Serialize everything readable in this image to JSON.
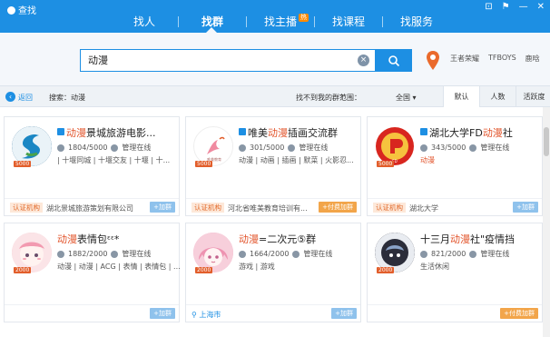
{
  "window": {
    "title": "查找",
    "controls": [
      "⊡",
      "⚑",
      "—",
      "✕"
    ]
  },
  "nav": [
    {
      "label": "找人",
      "hot": ""
    },
    {
      "label": "找群",
      "hot": ""
    },
    {
      "label": "找主播",
      "hot": "热"
    },
    {
      "label": "找课程",
      "hot": ""
    },
    {
      "label": "找服务",
      "hot": ""
    }
  ],
  "search": {
    "value": "动漫",
    "clear": "×"
  },
  "hot_words": [
    "王者荣耀",
    "TFBOYS",
    "鹿晗"
  ],
  "filter": {
    "back_label": "返回",
    "search_info": "搜索：动漫",
    "not_found": "找不到我的群？",
    "range_label": "范围：",
    "range_value": "全国",
    "tabs": [
      "默认",
      "人数",
      "活跃度"
    ]
  },
  "cards": [
    {
      "title_hl": "动漫",
      "title_rest": "景城旅游电影...",
      "members": "1804/5000",
      "admin": "管理在线",
      "tags": "| 十堰同城 | 十堰交友 | 十堰 | 十...",
      "badge": "认证机构",
      "org": "湖北景城旅游策划有限公司",
      "join": "+加群",
      "paid": false,
      "lvl": "5000",
      "avatar_bg": "#1c5f8e"
    },
    {
      "title_pre": "唯美",
      "title_hl": "动漫",
      "title_rest": "插画交流群",
      "members": "301/5000",
      "admin": "管理在线",
      "tags": "动漫 | 动画 | 插画 | 默菜 | 火影忍...",
      "badge": "认证机构",
      "org": "河北省唯美教育培训有...",
      "join": "+付费加群",
      "paid": true,
      "lvl": "5000",
      "avatar_bg": "#ffffff"
    },
    {
      "title_pre": "湖北大学FD",
      "title_hl": "动漫",
      "title_rest": "社",
      "members": "343/5000",
      "admin": "管理在线",
      "tags": "动漫",
      "badge": "认证机构",
      "org": "湖北大学",
      "join": "+加群",
      "paid": false,
      "lvl": "5000",
      "avatar_bg": "#d8261f"
    },
    {
      "title_hl": "动漫",
      "title_rest": "表情包ᵋᵋ*",
      "members": "1882/2000",
      "admin": "管理在线",
      "tags": "动漫 | 动漫 | ACG | 表情 | 表情包 | ...",
      "badge": "",
      "org": "",
      "join": "+加群",
      "paid": false,
      "lvl": "2000",
      "avatar_bg": "#f4c6cc"
    },
    {
      "title_hl": "动漫",
      "title_rest": "=二次元⑤群",
      "members": "1664/2000",
      "admin": "管理在线",
      "tags": "游戏 | 游戏",
      "badge": "",
      "org": "",
      "loc": "上海市",
      "join": "+加群",
      "paid": false,
      "lvl": "2000",
      "avatar_bg": "#f0a7be"
    },
    {
      "title_pre": "十三月",
      "title_hl": "动漫",
      "title_rest": "社\"疫情挡",
      "members": "821/2000",
      "admin": "管理在线",
      "tags": "生活休闲",
      "badge": "",
      "org": "",
      "join": "+付费加群",
      "paid": true,
      "lvl": "2000",
      "avatar_bg": "#2b2d3a"
    }
  ]
}
